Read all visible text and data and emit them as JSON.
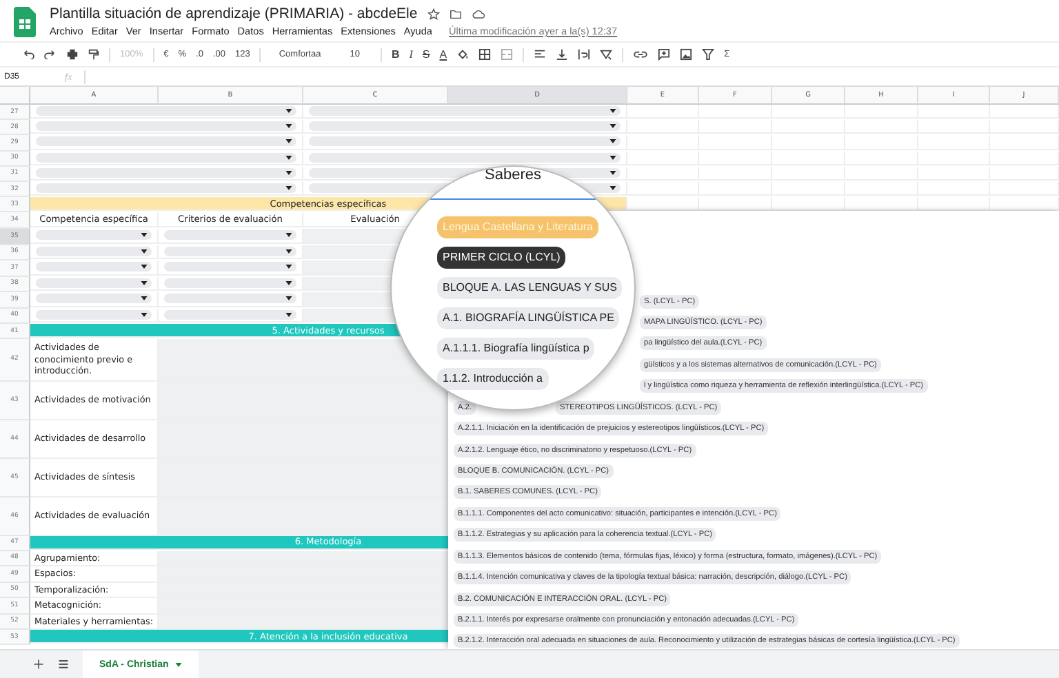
{
  "window": {
    "title": "Plantilla situación de aprendizaje (PRIMARIA) - abcdeEle"
  },
  "menu": [
    "Archivo",
    "Editar",
    "Ver",
    "Insertar",
    "Formato",
    "Datos",
    "Herramientas",
    "Extensiones",
    "Ayuda"
  ],
  "last_edit": "Última modificación ayer a la(s) 12:37",
  "toolbar": {
    "zoom": {
      "label": "100%",
      "disabled": true
    },
    "number_formats": [
      "€",
      "%",
      ".0",
      ".00",
      "123"
    ],
    "font": "Comfortaa",
    "size": "10",
    "styles": [
      "B",
      "I",
      "S",
      "A"
    ],
    "sum": "Σ"
  },
  "formula_bar": {
    "cell": "D35",
    "fx": "fx"
  },
  "columns": [
    {
      "label": "A",
      "selected": false
    },
    {
      "label": "B",
      "selected": false
    },
    {
      "label": "C",
      "selected": false
    },
    {
      "label": "D",
      "selected": true
    },
    {
      "label": "E",
      "selected": false
    },
    {
      "label": "F",
      "selected": false
    },
    {
      "label": "G",
      "selected": false
    },
    {
      "label": "H",
      "selected": false
    },
    {
      "label": "I",
      "selected": false
    },
    {
      "label": "J",
      "selected": false
    }
  ],
  "rows": [
    {
      "num": "27",
      "kind": "selects_wide",
      "selected": false
    },
    {
      "num": "28",
      "kind": "selects_wide",
      "selected": false
    },
    {
      "num": "29",
      "kind": "selects_wide",
      "selected": false
    },
    {
      "num": "30",
      "kind": "selects_wide",
      "selected": false
    },
    {
      "num": "31",
      "kind": "selects_wide",
      "selected": false
    },
    {
      "num": "32",
      "kind": "selects_wide",
      "selected": false
    },
    {
      "num": "33",
      "kind": "subband",
      "selected": false,
      "text": "Competencias específicas"
    },
    {
      "num": "34",
      "kind": "headers",
      "selected": false,
      "cells": [
        "Competencia específica",
        "Criterios de evaluación",
        "Evaluación"
      ]
    },
    {
      "num": "35",
      "kind": "selects",
      "selected": true
    },
    {
      "num": "36",
      "kind": "selects",
      "selected": false
    },
    {
      "num": "37",
      "kind": "selects",
      "selected": false
    },
    {
      "num": "38",
      "kind": "selects",
      "selected": false
    },
    {
      "num": "39",
      "kind": "selects",
      "selected": false
    },
    {
      "num": "40",
      "kind": "selects",
      "selected": false
    },
    {
      "num": "41",
      "kind": "band",
      "selected": false,
      "text": "5. Actividades y recursos"
    },
    {
      "num": "42",
      "kind": "activity",
      "selected": false,
      "text": "Actividades de conocimiento previo e introducción."
    },
    {
      "num": "43",
      "kind": "activity",
      "selected": false,
      "text": "Actividades de motivación"
    },
    {
      "num": "44",
      "kind": "activity",
      "selected": false,
      "text": "Actividades de desarrollo"
    },
    {
      "num": "45",
      "kind": "activity",
      "selected": false,
      "text": "Actividades de síntesis"
    },
    {
      "num": "46",
      "kind": "activity",
      "selected": false,
      "text": "Actividades de evaluación"
    },
    {
      "num": "47",
      "kind": "band",
      "selected": false,
      "text": "6. Metodología"
    },
    {
      "num": "48",
      "kind": "field",
      "selected": false,
      "text": "Agrupamiento:"
    },
    {
      "num": "49",
      "kind": "field",
      "selected": false,
      "text": "Espacios:"
    },
    {
      "num": "50",
      "kind": "field",
      "selected": false,
      "text": "Temporalización:"
    },
    {
      "num": "51",
      "kind": "field",
      "selected": false,
      "text": "Metacognición:"
    },
    {
      "num": "52",
      "kind": "field",
      "selected": false,
      "text": "Materiales y herramientas:"
    },
    {
      "num": "53",
      "kind": "band",
      "selected": false,
      "text": "7. Atención a la inclusión educativa"
    }
  ],
  "dropdown": {
    "items": [
      {
        "kind": "partial",
        "text": "S. (LCYL - PC)"
      },
      {
        "kind": "partial",
        "text": "MAPA LINGÜÍSTICO. (LCYL - PC)"
      },
      {
        "kind": "partial",
        "text": "pa lingüístico del aula.(LCYL - PC)"
      },
      {
        "kind": "partial",
        "text": "güísticos y a los sistemas alternativos de comunicación.(LCYL - PC)"
      },
      {
        "kind": "partial",
        "text": "l y lingüística como riqueza y herramienta de reflexión interlingüística.(LCYL - PC)"
      },
      {
        "kind": "split",
        "lead": "A.2.",
        "text": "STEREOTIPOS LINGÜÍSTICOS. (LCYL - PC)"
      },
      {
        "kind": "full",
        "text": "A.2.1.1. Iniciación en la identificación de prejuicios y estereotipos lingüísticos.(LCYL - PC)"
      },
      {
        "kind": "full",
        "text": "A.2.1.2. Lenguaje ético, no discriminatorio y respetuoso.(LCYL - PC)"
      },
      {
        "kind": "full",
        "text": "BLOQUE B. COMUNICACIÓN. (LCYL - PC)"
      },
      {
        "kind": "full",
        "text": "B.1. SABERES COMUNES. (LCYL - PC)"
      },
      {
        "kind": "full",
        "text": "B.1.1.1. Componentes del acto comunicativo: situación, participantes e intención.(LCYL - PC)"
      },
      {
        "kind": "full",
        "text": "B.1.1.2. Estrategias y su aplicación para la coherencia textual.(LCYL - PC)"
      },
      {
        "kind": "full",
        "text": "B.1.1.3. Elementos básicos de contenido (tema, fórmulas fijas, léxico) y forma (estructura, formato, imágenes).(LCYL - PC)"
      },
      {
        "kind": "full",
        "text": "B.1.1.4. Intención comunicativa y claves de la tipología textual básica: narración, descripción, diálogo.(LCYL - PC)"
      },
      {
        "kind": "full",
        "text": "B.2. COMUNICACIÓN E INTERACCIÓN ORAL. (LCYL - PC)"
      },
      {
        "kind": "full",
        "text": "B.2.1.1. Interés por expresarse oralmente con pronunciación y entonación adecuadas.(LCYL - PC)"
      },
      {
        "kind": "full",
        "text": "B.2.1.2. Interacción oral adecuada en situaciones de aula. Reconocimiento y utilización de estrategias básicas de cortesía lingüística.(LCYL - PC)"
      }
    ]
  },
  "magnifier": {
    "header": "Saberes",
    "items": [
      {
        "kind": "subject",
        "text": "Lengua Castellana y Literatura"
      },
      {
        "kind": "cycle",
        "text": "PRIMER CICLO (LCYL)"
      },
      {
        "kind": "entry",
        "text": "BLOQUE A. LAS LENGUAS Y SUS"
      },
      {
        "kind": "entry",
        "text": "A.1. BIOGRAFÍA LINGÜÍSTICA PE"
      },
      {
        "kind": "entry",
        "text": "A.1.1.1. Biografía lingüística p"
      },
      {
        "kind": "entry",
        "text": "1.1.2. Introducción a"
      }
    ]
  },
  "sheet_tabs": [
    {
      "label": "SdA - Christian",
      "selected": true
    }
  ]
}
